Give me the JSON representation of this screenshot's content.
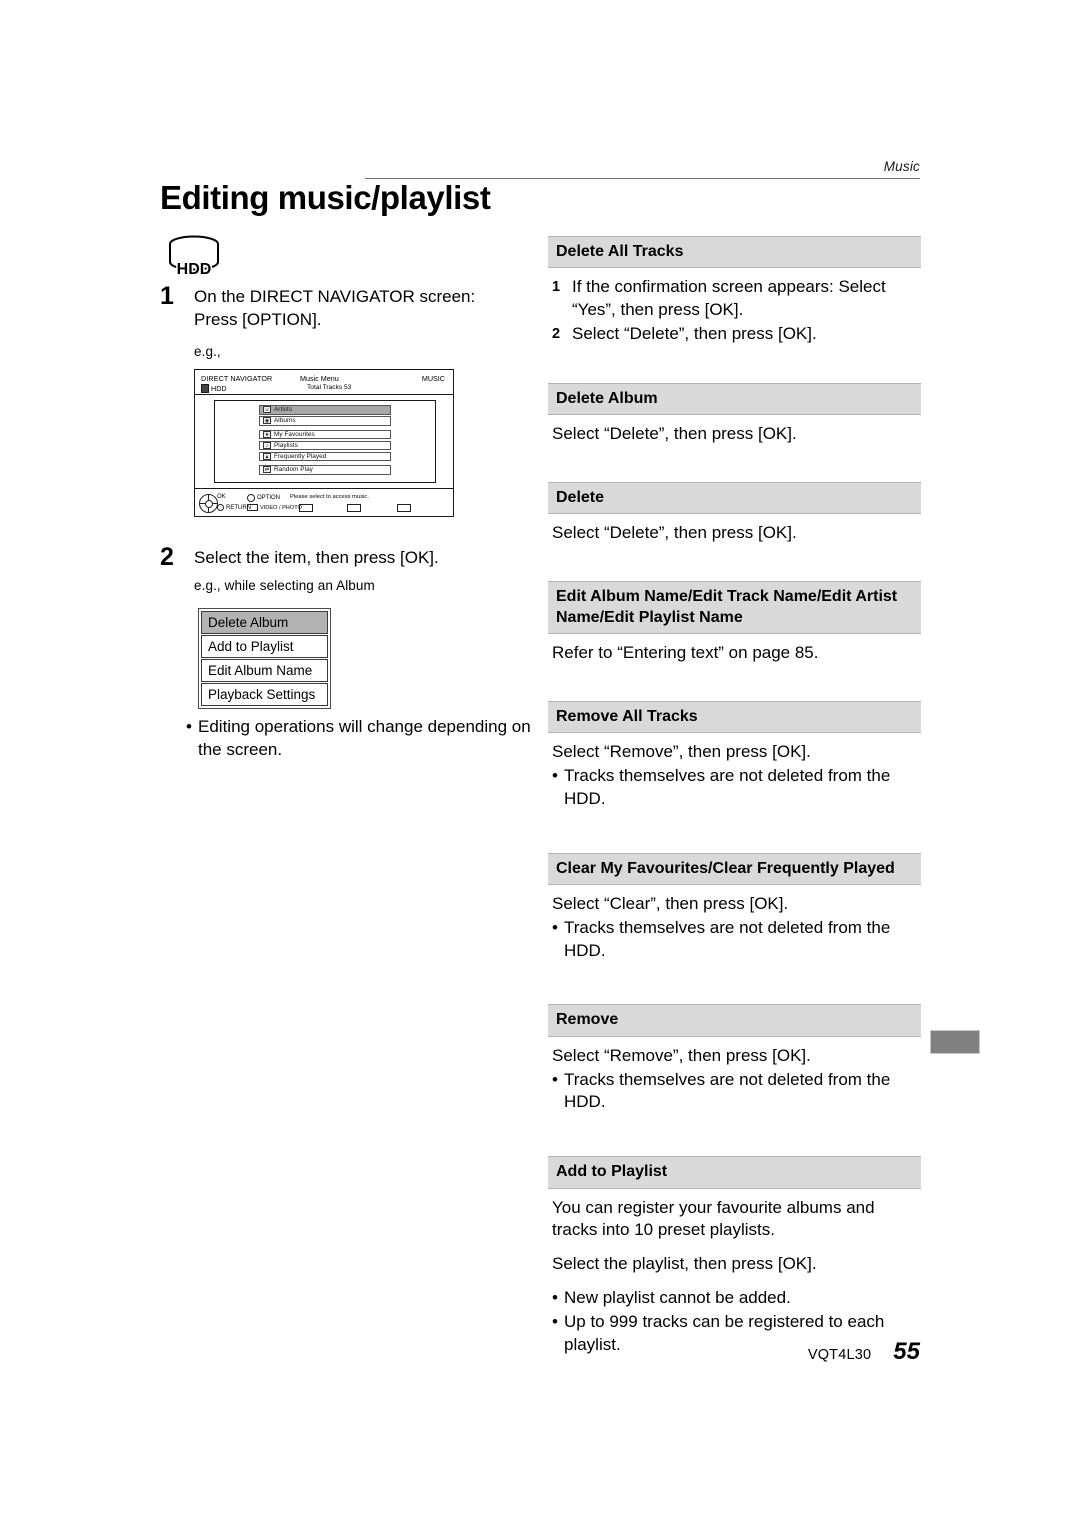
{
  "running_head": "Music",
  "page_title": "Editing music/playlist",
  "media_icon": {
    "label": "HDD"
  },
  "steps": [
    {
      "number": "1",
      "line1": "On the DIRECT NAVIGATOR screen:",
      "line2": "Press [OPTION].",
      "eg": "e.g.,"
    },
    {
      "number": "2",
      "line1": "Select the item, then press [OK].",
      "eg": "e.g., while selecting an Album"
    }
  ],
  "tv_screen": {
    "title": "DIRECT NAVIGATOR",
    "source": "HDD",
    "menu_title": "Music Menu",
    "total_tracks": "Total Tracks  53",
    "mode": "MUSIC",
    "groups": [
      {
        "items": [
          {
            "label": "Artists",
            "icon": "person-icon",
            "selected": true
          },
          {
            "label": "Albums",
            "icon": "disc-icon",
            "selected": false
          }
        ]
      },
      {
        "items": [
          {
            "label": "My Favourites",
            "icon": "star-icon",
            "selected": false
          },
          {
            "label": "Playlists",
            "icon": "playlist-icon",
            "selected": false
          },
          {
            "label": "Frequently Played",
            "icon": "chart-icon",
            "selected": false
          }
        ]
      },
      {
        "items": [
          {
            "label": "Random Play",
            "icon": "shuffle-icon",
            "selected": false
          }
        ]
      }
    ],
    "footer": {
      "ok": "OK",
      "return": "RETURN",
      "option": "OPTION",
      "video_photo": "VIDEO / PHOTO",
      "message": "Please select to access music."
    }
  },
  "option_menu": {
    "items": [
      {
        "label": "Delete Album",
        "selected": true
      },
      {
        "label": "Add to Playlist",
        "selected": false
      },
      {
        "label": "Edit Album Name",
        "selected": false
      },
      {
        "label": "Playback Settings",
        "selected": false
      }
    ]
  },
  "left_note": {
    "bullet": "•",
    "text": "Editing operations will change depending on the screen."
  },
  "sections": [
    {
      "heading": "Delete All Tracks",
      "steps": [
        {
          "n": "1",
          "text": "If the confirmation screen appears: Select “Yes”, then press [OK]."
        },
        {
          "n": "2",
          "text": "Select “Delete”, then press [OK]."
        }
      ]
    },
    {
      "heading": "Delete Album",
      "body": "Select “Delete”, then press [OK]."
    },
    {
      "heading": "Delete",
      "body": "Select “Delete”, then press [OK]."
    },
    {
      "heading": "Edit Album Name/Edit Track Name/Edit Artist Name/Edit Playlist Name",
      "body": "Refer to “Entering text” on page 85."
    },
    {
      "heading": "Remove All Tracks",
      "body": "Select “Remove”, then press [OK].",
      "bullets": [
        "Tracks themselves are not deleted from the HDD."
      ]
    },
    {
      "heading": "Clear My Favourites/Clear Frequently Played",
      "body": "Select “Clear”, then press [OK].",
      "bullets": [
        "Tracks themselves are not deleted from the HDD."
      ]
    },
    {
      "heading": "Remove",
      "body": "Select “Remove”, then press [OK].",
      "bullets": [
        "Tracks themselves are not deleted from the HDD."
      ]
    },
    {
      "heading": "Add to Playlist",
      "body": "You can register your favourite albums and tracks into 10 preset playlists.",
      "body2": "Select the playlist, then press [OK].",
      "bullets": [
        "New playlist cannot be added.",
        "Up to 999 tracks can be registered to each playlist."
      ]
    }
  ],
  "footer": {
    "model": "VQT4L30",
    "page_number": "55"
  }
}
